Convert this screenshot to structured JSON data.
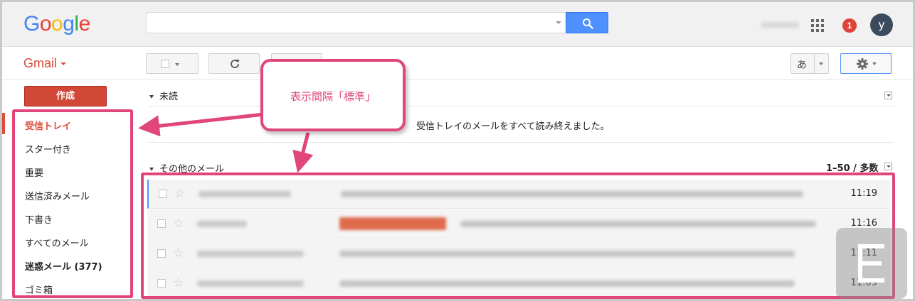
{
  "header": {
    "logo_letters": [
      "G",
      "o",
      "o",
      "g",
      "l",
      "e"
    ],
    "logo_colors": [
      "#4285f4",
      "#ea4335",
      "#fbbc05",
      "#4285f4",
      "#34a853",
      "#ea4335"
    ],
    "search_placeholder": "",
    "notification_count": "1",
    "avatar_initial": "y"
  },
  "toolbar": {
    "app_label": "Gmail",
    "input_tool_label": "あ"
  },
  "sidebar": {
    "compose_label": "作成",
    "items": [
      {
        "label": "受信トレイ",
        "state": "active"
      },
      {
        "label": "スター付き",
        "state": "normal"
      },
      {
        "label": "重要",
        "state": "normal"
      },
      {
        "label": "送信済みメール",
        "state": "normal"
      },
      {
        "label": "下書き",
        "state": "normal"
      },
      {
        "label": "すべてのメール",
        "state": "normal"
      },
      {
        "label": "迷惑メール (377)",
        "state": "bold"
      },
      {
        "label": "ゴミ箱",
        "state": "normal"
      }
    ]
  },
  "main": {
    "unread_section": {
      "title": "未読",
      "empty_message": "受信トレイのメールをすべて読み終えました。"
    },
    "other_section": {
      "title": "その他のメール",
      "count": "1–50 / 多数"
    },
    "rows": [
      {
        "time": "11:19"
      },
      {
        "time": "11:16"
      },
      {
        "time": "11:11"
      },
      {
        "time": "11:09"
      }
    ]
  },
  "annotation": {
    "callout_text": "表示間隔「標準」",
    "accent_color": "#e0457b"
  },
  "watermark": {
    "glyph_name": "e-letter-logo"
  }
}
